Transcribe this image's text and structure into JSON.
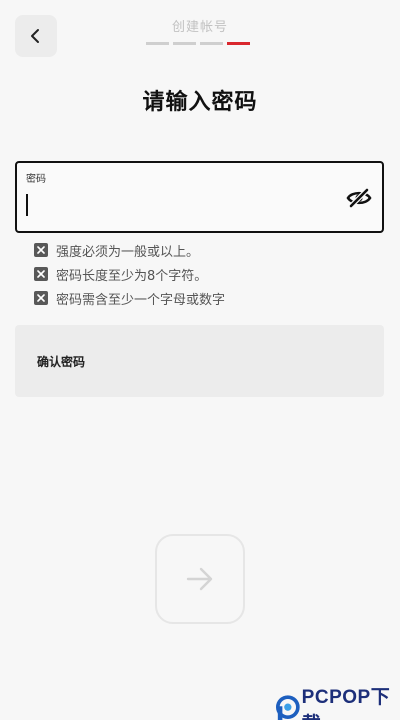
{
  "header": {
    "back_icon": "chevron-left-icon",
    "step_title": "创建帐号",
    "progress": {
      "total": 4,
      "current": 4,
      "active_color": "#d9272e",
      "inactive_color": "#cfcfcf"
    }
  },
  "page_title": "请输入密码",
  "password_field": {
    "label": "密码",
    "value": "",
    "visibility_icon": "eye-off-icon"
  },
  "requirements": [
    {
      "text": "强度必须为一般或以上。",
      "met": false
    },
    {
      "text": "密码长度至少为8个字符。",
      "met": false
    },
    {
      "text": "密码需含至少一个字母或数字",
      "met": false
    }
  ],
  "confirm_field": {
    "label": "确认密码"
  },
  "next_button": {
    "icon": "arrow-right-icon",
    "enabled": false
  },
  "watermark": {
    "text": "PCPOP下载"
  }
}
